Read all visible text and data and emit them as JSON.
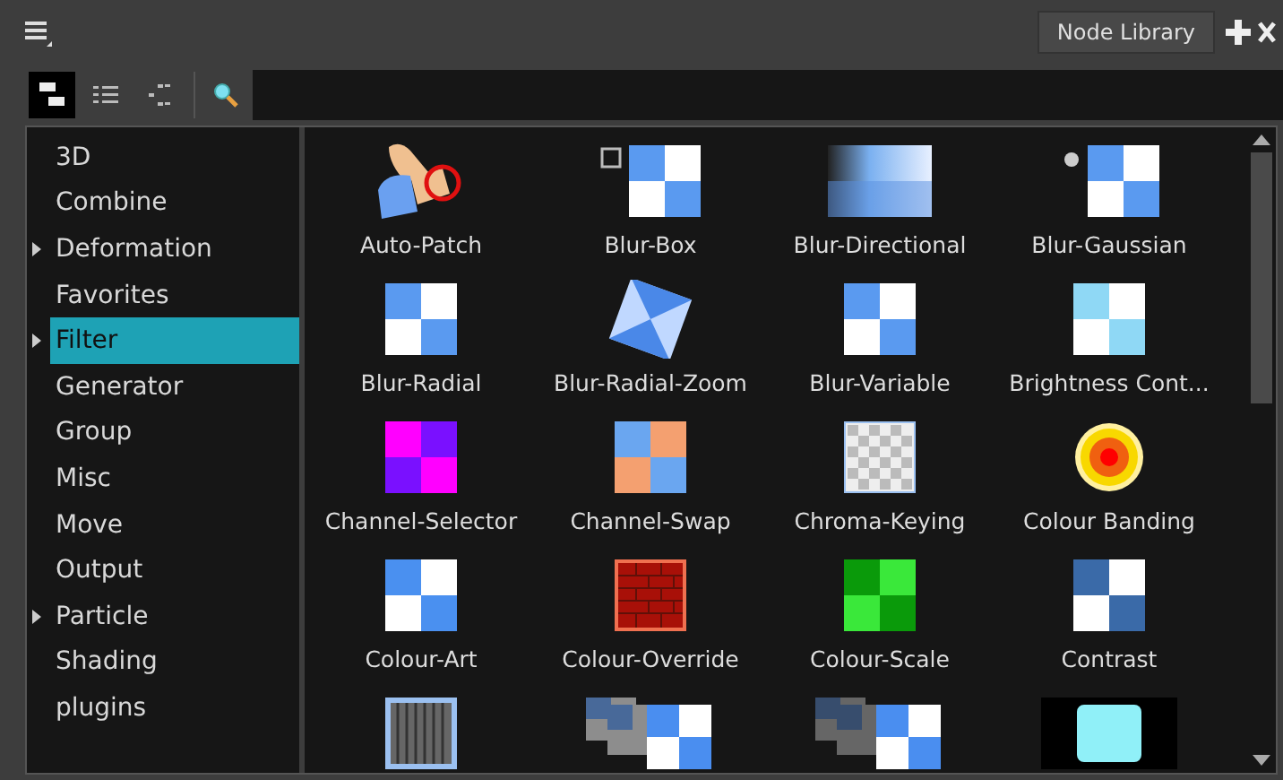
{
  "panel_tab": {
    "label": "Node Library"
  },
  "view_modes": [
    {
      "kind": "icons",
      "selected": true
    },
    {
      "kind": "list",
      "selected": false
    },
    {
      "kind": "tree",
      "selected": false
    }
  ],
  "categories": [
    {
      "label": "3D",
      "expandable": false,
      "selected": false
    },
    {
      "label": "Combine",
      "expandable": false,
      "selected": false
    },
    {
      "label": "Deformation",
      "expandable": true,
      "selected": false
    },
    {
      "label": "Favorites",
      "expandable": false,
      "selected": false
    },
    {
      "label": "Filter",
      "expandable": true,
      "selected": true
    },
    {
      "label": "Generator",
      "expandable": false,
      "selected": false
    },
    {
      "label": "Group",
      "expandable": false,
      "selected": false
    },
    {
      "label": "Misc",
      "expandable": false,
      "selected": false
    },
    {
      "label": "Move",
      "expandable": false,
      "selected": false
    },
    {
      "label": "Output",
      "expandable": false,
      "selected": false
    },
    {
      "label": "Particle",
      "expandable": true,
      "selected": false
    },
    {
      "label": "Shading",
      "expandable": false,
      "selected": false
    },
    {
      "label": "plugins",
      "expandable": false,
      "selected": false
    }
  ],
  "nodes": [
    {
      "label": "Auto-Patch",
      "kind": "patch"
    },
    {
      "label": "Blur-Box",
      "kind": "box"
    },
    {
      "label": "Blur-Directional",
      "kind": "directional"
    },
    {
      "label": "Blur-Gaussian",
      "kind": "gaussian"
    },
    {
      "label": "Blur-Radial",
      "kind": "checker-soft"
    },
    {
      "label": "Blur-Radial-Zoom",
      "kind": "swirl"
    },
    {
      "label": "Blur-Variable",
      "kind": "checker-soft"
    },
    {
      "label": "Brightness Cont...",
      "kind": "checker-light"
    },
    {
      "label": "Channel-Selector",
      "kind": "checker-magenta"
    },
    {
      "label": "Channel-Swap",
      "kind": "checker-orange"
    },
    {
      "label": "Chroma-Keying",
      "kind": "transparency"
    },
    {
      "label": "Colour Banding",
      "kind": "target"
    },
    {
      "label": "Colour-Art",
      "kind": "checker-blue"
    },
    {
      "label": "Colour-Override",
      "kind": "brick"
    },
    {
      "label": "Colour-Scale",
      "kind": "checker-green"
    },
    {
      "label": "Contrast",
      "kind": "checker-dark"
    },
    {
      "kind": "stripes"
    },
    {
      "kind": "stacked"
    },
    {
      "kind": "stacked-soft"
    },
    {
      "kind": "glow"
    }
  ]
}
